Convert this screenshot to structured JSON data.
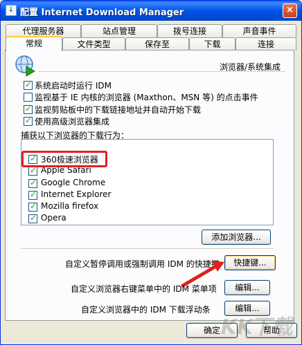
{
  "window": {
    "title": "配置 Internet Download Manager",
    "close_glyph": "×"
  },
  "tabs_row1": [
    "代理服务器",
    "站点管理",
    "拨号连接",
    "声音事件"
  ],
  "tabs_row2": [
    "常规",
    "文件类型",
    "保存至",
    "下载",
    "连接"
  ],
  "header": {
    "section_label": "浏览器/系统集成"
  },
  "options": [
    {
      "label": "系统启动时运行 IDM",
      "checked": true
    },
    {
      "label": "监视基于 IE 内核的浏览器 (Maxthon、MSN 等) 的点击事件",
      "checked": false
    },
    {
      "label": "监视剪贴板中的下载链接地址并自动开始下载",
      "checked": true
    },
    {
      "label": "使用高级浏览器集成",
      "checked": true
    }
  ],
  "browsers_group": {
    "label": "捕获以下浏览器的下载行为：",
    "items": [
      {
        "label": "360极速浏览器",
        "checked": true
      },
      {
        "label": "Apple Safari",
        "checked": true
      },
      {
        "label": "Google Chrome",
        "checked": true
      },
      {
        "label": "Internet Explorer",
        "checked": true
      },
      {
        "label": "Mozilla firefox",
        "checked": true
      },
      {
        "label": "Opera",
        "checked": true
      }
    ],
    "add_button": "添加浏览器..."
  },
  "hotkey": {
    "label": "自定义暂停调用或强制调用 IDM 的快捷键",
    "button": "快捷键..."
  },
  "context_menu": {
    "label": "自定义浏览器右键菜单中的 IDM 菜单项",
    "button": "编辑..."
  },
  "float_bar": {
    "label": "自定义浏览器中的 IDM 下载浮动条",
    "button": "编辑..."
  },
  "footer": {
    "ok": "确定",
    "help": "帮助"
  },
  "watermark": "KK下载",
  "colors": {
    "title_bar": "#0054e3",
    "highlight_box": "#e0201b",
    "arrow": "#e0201b"
  }
}
